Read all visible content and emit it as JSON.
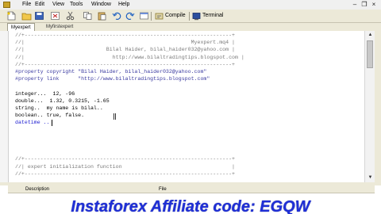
{
  "menubar": {
    "items": [
      "File",
      "Edit",
      "View",
      "Tools",
      "Window",
      "Help"
    ]
  },
  "toolbar": {
    "compile_label": "Compile",
    "terminal_label": "Terminal"
  },
  "tabs": [
    "Myexpert",
    "Myfirstexpert"
  ],
  "editor": {
    "lines": [
      {
        "text": "//+------------------------------------------------------------------+",
        "kind": "comment"
      },
      {
        "text": "//|                                                     Myexpert.mq4 |",
        "kind": "comment"
      },
      {
        "text": "//|                          Bilal Haider, bilal_haider032@yahoo.com |",
        "kind": "comment"
      },
      {
        "text": "//|                            http://www.bilaltradingtips.blogspot.com |",
        "kind": "comment"
      },
      {
        "text": "//+------------------------------------------------------------------+",
        "kind": "comment"
      },
      {
        "text": "#property copyright \"Bilal Haider, bilal_haider032@yahoo.com\"",
        "kind": "directive"
      },
      {
        "text": "#property link      \"http://www.bilaltradingtips.blogspot.com\"",
        "kind": "directive"
      },
      {
        "text": "",
        "kind": "plain"
      },
      {
        "text": "integer...  12, -96",
        "kind": "plain"
      },
      {
        "text": "double...  1.32, 0.3215, -1.65",
        "kind": "plain"
      },
      {
        "text": "string..  my name is bilal..",
        "kind": "plain"
      },
      {
        "text": "boolean.. true, false.",
        "kind": "plain"
      },
      {
        "text": "datetime ..",
        "kind": "keyword"
      },
      {
        "text": "",
        "kind": "plain"
      },
      {
        "text": "",
        "kind": "plain"
      },
      {
        "text": "",
        "kind": "plain"
      },
      {
        "text": "",
        "kind": "plain"
      },
      {
        "text": "//+------------------------------------------------------------------+",
        "kind": "comment"
      },
      {
        "text": "//| expert initialization function                                   |",
        "kind": "comment"
      },
      {
        "text": "//+------------------------------------------------------------------+",
        "kind": "comment"
      }
    ]
  },
  "bottom_panel": {
    "col_description": "Description",
    "col_file": "File"
  },
  "banner": {
    "text": "Instaforex Affiliate code: EGQW",
    "color": "#1f2fd6"
  }
}
